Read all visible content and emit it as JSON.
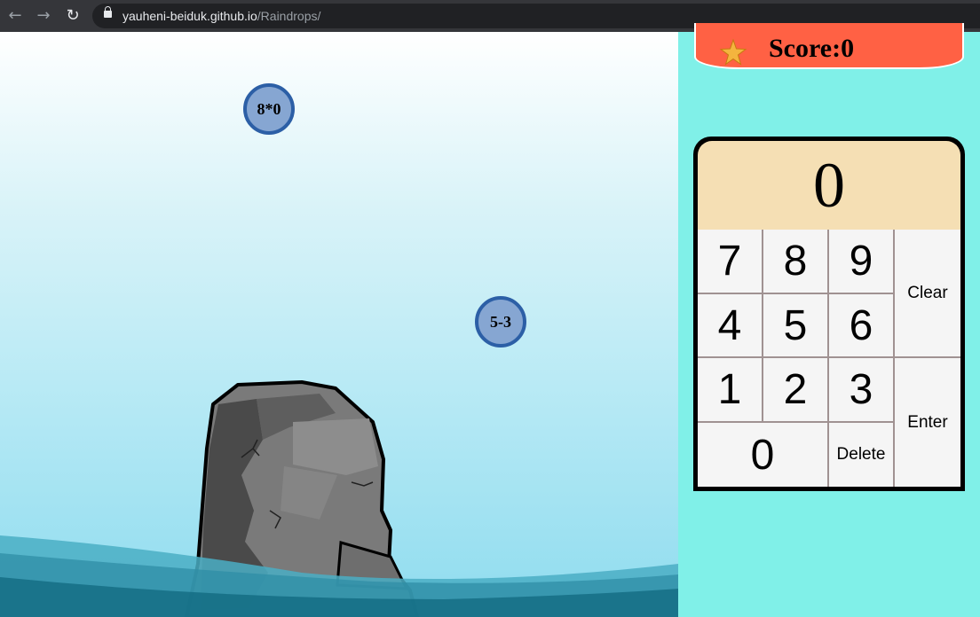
{
  "browser": {
    "domain": "yauheni-beiduk.github.io",
    "path": "/Raindrops/"
  },
  "drops": [
    {
      "expression": "8*0"
    },
    {
      "expression": "5-3"
    }
  ],
  "score": {
    "label": "Score:0"
  },
  "calculator": {
    "display": "0",
    "keys": {
      "k7": "7",
      "k8": "8",
      "k9": "9",
      "k4": "4",
      "k5": "5",
      "k6": "6",
      "k1": "1",
      "k2": "2",
      "k3": "3",
      "k0": "0",
      "clear": "Clear",
      "enter": "Enter",
      "delete": "Delete"
    }
  },
  "colors": {
    "drop_fill": "#86a6d2",
    "drop_border": "#2c5fa6",
    "score_bg": "#ff6144",
    "panel_bg": "#80f0e8",
    "display_bg": "#f5dfb4"
  },
  "icons": {
    "back": "arrow-left-icon",
    "forward": "arrow-right-icon",
    "reload": "reload-icon",
    "secure": "lock-icon",
    "score": "star-icon"
  }
}
